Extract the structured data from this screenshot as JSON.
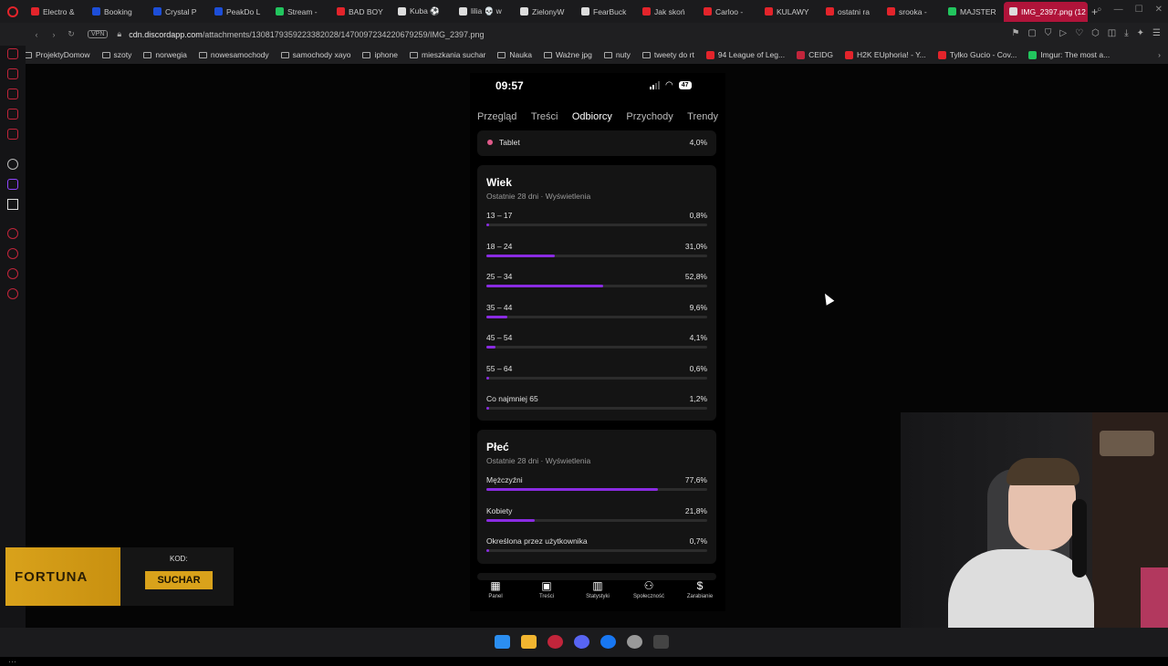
{
  "browser": {
    "tabs": [
      {
        "label": "Electro &",
        "color": "#e3242b"
      },
      {
        "label": "Booking",
        "color": "#1d4ed8"
      },
      {
        "label": "Crystal P",
        "color": "#1d4ed8"
      },
      {
        "label": "PeakDo L",
        "color": "#1d4ed8"
      },
      {
        "label": "Stream -",
        "color": "#22c55e"
      },
      {
        "label": "BAD BOY",
        "color": "#e3242b"
      },
      {
        "label": "Kuba ⚽",
        "color": "#ddd"
      },
      {
        "label": "lilia 💀 w",
        "color": "#ddd"
      },
      {
        "label": "ZielonyW",
        "color": "#ddd"
      },
      {
        "label": "FearBuck",
        "color": "#ddd"
      },
      {
        "label": "Jak skoń",
        "color": "#e3242b"
      },
      {
        "label": "Carloo -",
        "color": "#e3242b"
      },
      {
        "label": "KULAWY",
        "color": "#e3242b"
      },
      {
        "label": "ostatni ra",
        "color": "#e3242b"
      },
      {
        "label": "srooka -",
        "color": "#e3242b"
      },
      {
        "label": "MAJSTER",
        "color": "#22c55e"
      },
      {
        "label": "IMG_2397.png (12",
        "color": "#ddd",
        "active": true
      }
    ],
    "vpn_label": "VPN",
    "url_host": "cdn.discordapp.com",
    "url_path": "/attachments/1308179359223382028/1470097234220679259/IMG_2397.png",
    "bookmarks": [
      {
        "label": "ProjektyDomow",
        "type": "folder"
      },
      {
        "label": "szoty",
        "type": "folder"
      },
      {
        "label": "norwegia",
        "type": "folder"
      },
      {
        "label": "nowesamochody",
        "type": "folder"
      },
      {
        "label": "samochody xayo",
        "type": "folder"
      },
      {
        "label": "iphone",
        "type": "folder"
      },
      {
        "label": "mieszkania suchar",
        "type": "folder"
      },
      {
        "label": "Nauka",
        "type": "folder"
      },
      {
        "label": "Ważne jpg",
        "type": "folder"
      },
      {
        "label": "nuty",
        "type": "folder"
      },
      {
        "label": "tweety do rt",
        "type": "folder"
      },
      {
        "label": "94 League of Leg...",
        "type": "site",
        "color": "#e3242b"
      },
      {
        "label": "CEIDG",
        "type": "site",
        "color": "#c2253b"
      },
      {
        "label": "H2K EUphoria! - Y...",
        "type": "site",
        "color": "#e3242b"
      },
      {
        "label": "Tylko Gucio - Cov...",
        "type": "site",
        "color": "#e3242b"
      },
      {
        "label": "Imgur: The most a...",
        "type": "site",
        "color": "#22c55e"
      }
    ]
  },
  "phone": {
    "time": "09:57",
    "battery": "47",
    "tabs": [
      {
        "label": "Przegląd",
        "selected": false
      },
      {
        "label": "Treści",
        "selected": false
      },
      {
        "label": "Odbiorcy",
        "selected": true
      },
      {
        "label": "Przychody",
        "selected": false
      },
      {
        "label": "Trendy",
        "selected": false
      }
    ],
    "device_row": {
      "label": "Tablet",
      "value": "4,0%"
    },
    "age_card": {
      "title": "Wiek",
      "subtitle": "Ostatnie 28 dni · Wyświetlenia",
      "rows": [
        {
          "label": "13 – 17",
          "value": "0,8%",
          "pct": 0.8
        },
        {
          "label": "18 – 24",
          "value": "31,0%",
          "pct": 31.0
        },
        {
          "label": "25 – 34",
          "value": "52,8%",
          "pct": 52.8
        },
        {
          "label": "35 – 44",
          "value": "9,6%",
          "pct": 9.6
        },
        {
          "label": "45 – 54",
          "value": "4,1%",
          "pct": 4.1
        },
        {
          "label": "55 – 64",
          "value": "0,6%",
          "pct": 0.6
        },
        {
          "label": "Co najmniej 65",
          "value": "1,2%",
          "pct": 1.2
        }
      ]
    },
    "gender_card": {
      "title": "Płeć",
      "subtitle": "Ostatnie 28 dni · Wyświetlenia",
      "rows": [
        {
          "label": "Mężczyźni",
          "value": "77,6%",
          "pct": 77.6
        },
        {
          "label": "Kobiety",
          "value": "21,8%",
          "pct": 21.8
        },
        {
          "label": "Określona przez użytkownika",
          "value": "0,7%",
          "pct": 0.7
        }
      ]
    },
    "bottom_nav": [
      {
        "label": "Panel",
        "icon": "grid-icon",
        "glyph": "▦"
      },
      {
        "label": "Treści",
        "icon": "content-icon",
        "glyph": "▣"
      },
      {
        "label": "Statystyki",
        "icon": "stats-icon",
        "glyph": "▥"
      },
      {
        "label": "Społeczność",
        "icon": "community-icon",
        "glyph": "⚇"
      },
      {
        "label": "Zarabianie",
        "icon": "earnings-icon",
        "glyph": "$"
      }
    ]
  },
  "promo": {
    "brand": "FORTUNA",
    "code_label": "KOD:",
    "code": "SUCHAR"
  },
  "colors": {
    "accent": "#8a2be2",
    "active_tab": "#b0143a",
    "device_dot": "#e05a8a",
    "promo_yellow": "#d9a21b"
  }
}
